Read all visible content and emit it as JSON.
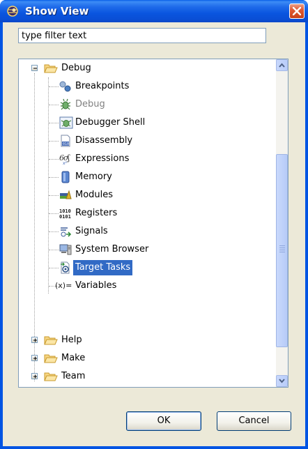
{
  "dialog": {
    "title": "Show View",
    "title_icon": "eclipse-icon",
    "close_icon": "close-icon"
  },
  "filter": {
    "value": "type filter text"
  },
  "tree": {
    "categories": [
      {
        "label": "Debug",
        "icon": "folder-open-icon",
        "expanded": true
      },
      {
        "label": "Help",
        "icon": "folder-icon",
        "expanded": false
      },
      {
        "label": "Make",
        "icon": "folder-icon",
        "expanded": false
      },
      {
        "label": "Team",
        "icon": "folder-icon",
        "expanded": false
      }
    ],
    "debug_views": [
      {
        "label": "Breakpoints",
        "icon": "breakpoints-icon",
        "state": "normal"
      },
      {
        "label": "Debug",
        "icon": "debug-bug-icon",
        "state": "disabled"
      },
      {
        "label": "Debugger Shell",
        "icon": "debugger-shell-icon",
        "state": "normal"
      },
      {
        "label": "Disassembly",
        "icon": "disassembly-icon",
        "state": "normal"
      },
      {
        "label": "Expressions",
        "icon": "expressions-icon",
        "state": "normal"
      },
      {
        "label": "Memory",
        "icon": "memory-icon",
        "state": "normal"
      },
      {
        "label": "Modules",
        "icon": "modules-icon",
        "state": "normal"
      },
      {
        "label": "Registers",
        "icon": "registers-icon",
        "state": "normal"
      },
      {
        "label": "Signals",
        "icon": "signals-icon",
        "state": "normal"
      },
      {
        "label": "System Browser",
        "icon": "system-browser-icon",
        "state": "normal"
      },
      {
        "label": "Target Tasks",
        "icon": "target-tasks-icon",
        "state": "selected"
      },
      {
        "label": "Variables",
        "icon": "variables-icon",
        "state": "normal"
      }
    ],
    "registers_glyph": "1010\n0101",
    "variables_glyph": "(x)="
  },
  "buttons": {
    "ok": "OK",
    "cancel": "Cancel"
  },
  "colors": {
    "title_bar": "#0a55df",
    "selection": "#316ac5",
    "dialog_bg": "#ece9d8"
  }
}
